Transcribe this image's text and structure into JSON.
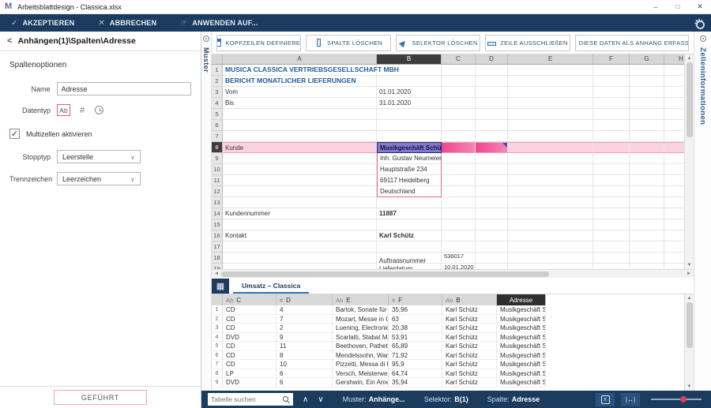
{
  "window": {
    "title": "Arbeitsblattdesign - Classica.xlsx"
  },
  "toolbar": {
    "accept": "AKZEPTIEREN",
    "cancel": "ABBRECHEN",
    "apply": "ANWENDEN AUF..."
  },
  "panel": {
    "breadcrumb": "Anhängen(1)\\Spalten\\Adresse",
    "section": "Spaltenoptionen",
    "name_label": "Name",
    "name_value": "Adresse",
    "datatype_label": "Datentyp",
    "datatype_text_option": "Ab",
    "datatype_number_option": "#",
    "multicell_label": "Multizellen aktivieren",
    "multicell_checked": true,
    "stop_label": "Stopptyp",
    "stop_value": "Leerstelle",
    "separator_label": "Trennzeichen",
    "separator_value": "Leerzeichen",
    "mode_button": "GEFÜHRT"
  },
  "side_tabs": {
    "left": "Muster",
    "right": "Zelleninformationen"
  },
  "actions": [
    {
      "label": "KOPFZEILEN DEFINIEREN",
      "icon": "define-headers-icon"
    },
    {
      "label": "SPALTE LÖSCHEN",
      "icon": "delete-column-icon"
    },
    {
      "label": "SELEKTOR LÖSCHEN",
      "icon": "delete-selector-icon"
    },
    {
      "label": "ZEILE AUSSCHLIEßEN",
      "icon": "exclude-row-icon"
    },
    {
      "label": "DIESE DATEN ALS ANHANG ERFASSEN",
      "icon": "capture-as-append-icon"
    }
  ],
  "spreadsheet": {
    "columns": [
      "A",
      "B",
      "C",
      "D",
      "E",
      "F",
      "G",
      "H"
    ],
    "selected_column": "B",
    "selection_band": {
      "from": "B",
      "to": "D"
    },
    "multicell_box": {
      "col": "B",
      "from_row": 9,
      "to_row": 12
    },
    "rows": [
      {
        "n": 1,
        "cells": {
          "A": {
            "text": "MUSICA CLASSICA VERTRIEBSGESELLSCHAFT MBH",
            "style": "c-title"
          }
        }
      },
      {
        "n": 2,
        "cells": {
          "A": {
            "text": "BERICHT MONATLICHER LIEFERUNGEN",
            "style": "c-title"
          }
        }
      },
      {
        "n": 3,
        "cells": {
          "A": {
            "text": "Vom"
          },
          "B": {
            "text": "01.01.2020"
          }
        }
      },
      {
        "n": 4,
        "cells": {
          "A": {
            "text": "Bis"
          },
          "B": {
            "text": "31.01.2020"
          }
        }
      },
      {
        "n": 5
      },
      {
        "n": 6
      },
      {
        "n": 7
      },
      {
        "n": 8,
        "highlight": true,
        "cells": {
          "A": {
            "text": "Kunde"
          },
          "B": {
            "text": "Musikgeschäft Schütz",
            "style": "c-sel"
          }
        }
      },
      {
        "n": 9,
        "cells": {
          "B": {
            "text": "Inh. Gustav Neumeier"
          }
        }
      },
      {
        "n": 10,
        "cells": {
          "B": {
            "text": "Hauptstraße 234"
          }
        }
      },
      {
        "n": 11,
        "cells": {
          "B": {
            "text": "69117 Heidelberg"
          }
        }
      },
      {
        "n": 12,
        "cells": {
          "B": {
            "text": "Deutschland"
          }
        }
      },
      {
        "n": 13
      },
      {
        "n": 14,
        "cells": {
          "A": {
            "text": "Kundennummer"
          },
          "B": {
            "text": "11887",
            "style": "c-bold"
          }
        }
      },
      {
        "n": 15
      },
      {
        "n": 16,
        "cells": {
          "A": {
            "text": "Kontakt"
          },
          "B": {
            "text": "Karl Schütz",
            "style": "c-bold"
          }
        }
      },
      {
        "n": 17
      },
      {
        "n": 18,
        "cells": {
          "B": {
            "text": "Auftragsnummer",
            "style": "va-b"
          },
          "C": {
            "text": "536017",
            "style": "va-t"
          }
        }
      },
      {
        "n": 19,
        "cells": {
          "B": {
            "text": "Lieferdatum"
          },
          "C": {
            "text": "10.01.2020",
            "style": "va-t"
          }
        }
      }
    ]
  },
  "sheet_tab": "Umsatz – Classica",
  "bottom_table": {
    "headers": [
      {
        "prefix": "Ab",
        "label": "C"
      },
      {
        "prefix": "#",
        "label": "D"
      },
      {
        "prefix": "Ab",
        "label": "E"
      },
      {
        "prefix": "#",
        "label": "F"
      },
      {
        "prefix": "Ab",
        "label": "B"
      },
      {
        "prefix": "",
        "label": "Adresse",
        "selected": true
      }
    ],
    "rows": [
      [
        "CD",
        "4",
        "Bartok, Sonate für So...",
        "35,96",
        "Karl Schütz",
        "Musikgeschäft Sc..."
      ],
      [
        "CD",
        "7",
        "Mozart, Messe in C, K...",
        "63",
        "Karl Schütz",
        "Musikgeschäft Sc..."
      ],
      [
        "CD",
        "2",
        "Luening, Electronic M...",
        "20,38",
        "Karl Schütz",
        "Musikgeschäft Sc..."
      ],
      [
        "DVD",
        "9",
        "Scarlatti, Stabat Mater",
        "53,91",
        "Karl Schütz",
        "Musikgeschäft Sc..."
      ],
      [
        "CD",
        "11",
        "Beethoven, Pathetiqu...",
        "65,89",
        "Karl Schütz",
        "Musikgeschäft Sc..."
      ],
      [
        "CD",
        "8",
        "Mendelssohn, War M...",
        "71,92",
        "Karl Schütz",
        "Musikgeschäft Sc..."
      ],
      [
        "CD",
        "10",
        "Pizzetti, Messa di Re...",
        "95,9",
        "Karl Schütz",
        "Musikgeschäft Sc..."
      ],
      [
        "LP",
        "6",
        "Versch, Meisterwerk...",
        "64,74",
        "Karl Schütz",
        "Musikgeschäft Sc..."
      ],
      [
        "DVD",
        "6",
        "Gershwin, Ein Amerik...",
        "35,94",
        "Karl Schütz",
        "Musikgeschäft Sc..."
      ]
    ]
  },
  "status": {
    "search_placeholder": "Tabelle suchen",
    "muster_label": "Muster:",
    "muster_value": "Anhänge...",
    "selector_label": "Selektor:",
    "selector_value": "B(1)",
    "column_label": "Spalte:",
    "column_value": "Adresse"
  },
  "colors": {
    "accent_navy": "#1b3c5f",
    "selection_pink": "#f04592",
    "selection_purple": "#8478d2",
    "icon_blue": "#2e75b6",
    "slider_red": "#e03e52"
  }
}
